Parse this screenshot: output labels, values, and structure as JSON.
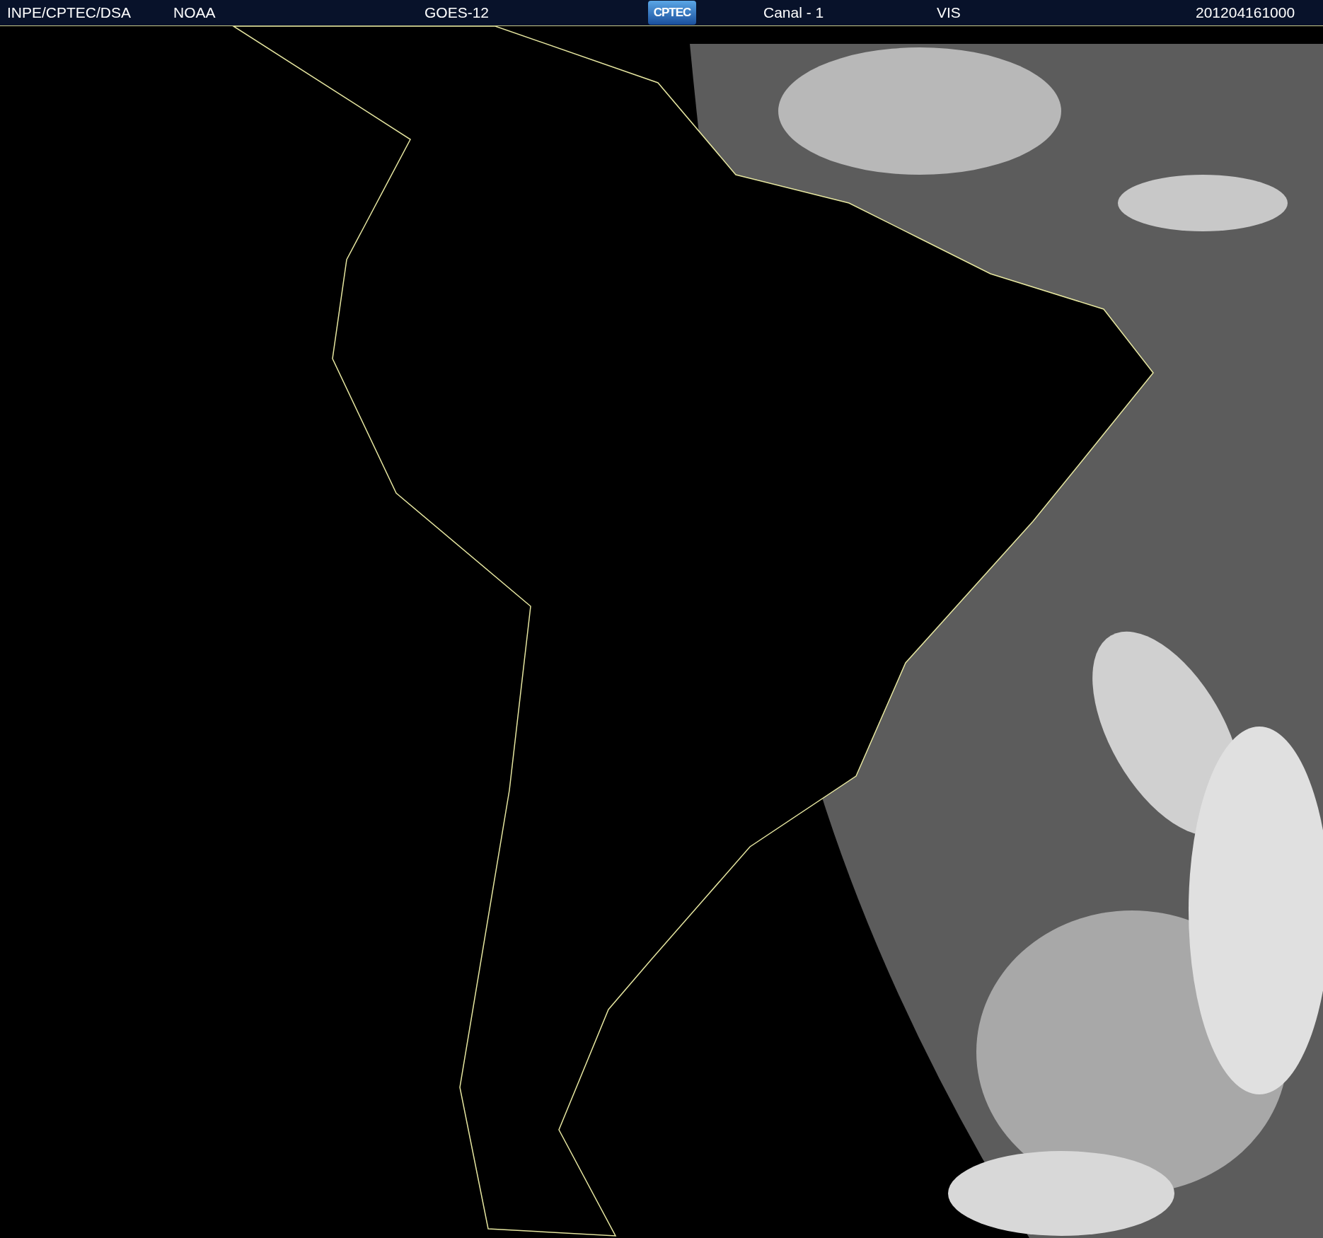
{
  "header": {
    "agency": "INPE/CPTEC/DSA",
    "source": "NOAA",
    "satellite": "GOES-12",
    "logo": "CPTEC",
    "channel": "Canal - 1",
    "band": "VIS",
    "timestamp": "201204161000"
  }
}
